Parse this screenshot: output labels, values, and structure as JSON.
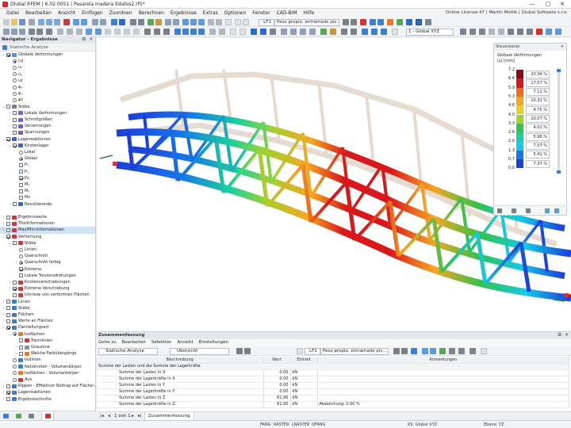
{
  "window": {
    "title": "Dlubal RFEM | 6.02.0051 | Pasarela madera Edatos2.rf5*",
    "controls": [
      "—",
      "□",
      "✕"
    ]
  },
  "menu": {
    "items": [
      "Datei",
      "Bearbeiten",
      "Ansicht",
      "Einfügen",
      "Zuordnen",
      "Berechnen",
      "Ergebnisse",
      "Extras",
      "Optionen",
      "Fenster",
      "CAD-BIM",
      "Hilfe"
    ],
    "license": "Online License 47 | Martin Motlik | Dlubal Software s.r.o."
  },
  "toolbar": {
    "lc_tag": "LF1",
    "lc_name": "Peso propio, entramado pis...",
    "view_combo": "1 - Global XYZ"
  },
  "navigator": {
    "title": "Navigator - Ergebnisse",
    "analysis": "Statische Analyse",
    "tree": [
      {
        "label": "Globale Verformungen",
        "level": 0,
        "kind": "check",
        "on": true,
        "exp": "v",
        "color": "#5b8fd6"
      },
      {
        "label": "|u|",
        "level": 1,
        "kind": "radio",
        "on": true
      },
      {
        "label": "uₓ",
        "level": 1,
        "kind": "radio",
        "on": false
      },
      {
        "label": "uᵧ",
        "level": 1,
        "kind": "radio",
        "on": false
      },
      {
        "label": "uz",
        "level": 1,
        "kind": "radio",
        "on": false
      },
      {
        "label": "φₓ",
        "level": 1,
        "kind": "radio",
        "on": false
      },
      {
        "label": "φᵧ",
        "level": 1,
        "kind": "radio",
        "on": false
      },
      {
        "label": "φz",
        "level": 1,
        "kind": "radio",
        "on": false
      },
      {
        "label": "Stäbe",
        "level": 0,
        "kind": "check",
        "on": false,
        "exp": "v",
        "color": "#7a7f88"
      },
      {
        "label": "Lokale Verformungen",
        "level": 1,
        "kind": "check",
        "on": false,
        "exp": ">",
        "color": "#7b5cc2"
      },
      {
        "label": "Schnittgrößen",
        "level": 1,
        "kind": "check",
        "on": false,
        "exp": ">",
        "color": "#7b5cc2"
      },
      {
        "label": "Verzerrungen",
        "level": 1,
        "kind": "check",
        "on": false,
        "exp": ">",
        "color": "#7b5cc2"
      },
      {
        "label": "Spannungen",
        "level": 1,
        "kind": "check",
        "on": false,
        "exp": ">",
        "color": "#7b5cc2"
      },
      {
        "label": "Lagerreaktionen",
        "level": 0,
        "kind": "check",
        "on": true,
        "exp": "v",
        "color": "#2d6bc7"
      },
      {
        "label": "Knotenlager",
        "level": 1,
        "kind": "check",
        "on": true,
        "exp": "v",
        "color": "#2d6bc7"
      },
      {
        "label": "Lokal",
        "level": 2,
        "kind": "radio",
        "on": false
      },
      {
        "label": "Global",
        "level": 2,
        "kind": "radio",
        "on": true
      },
      {
        "label": "Pₓ",
        "level": 2,
        "kind": "check",
        "on": false
      },
      {
        "label": "Pᵧ",
        "level": 2,
        "kind": "check",
        "on": false
      },
      {
        "label": "Pz",
        "level": 2,
        "kind": "check",
        "on": true
      },
      {
        "label": "Mₓ",
        "level": 2,
        "kind": "check",
        "on": false
      },
      {
        "label": "Mᵧ",
        "level": 2,
        "kind": "check",
        "on": false
      },
      {
        "label": "Mz",
        "level": 2,
        "kind": "check",
        "on": false
      },
      {
        "label": "Resultierende",
        "level": 1,
        "kind": "check",
        "on": false,
        "exp": ">",
        "color": "#2d6bc7"
      },
      {
        "label": "",
        "level": 0,
        "kind": "gap"
      },
      {
        "label": "Ergebniswerte",
        "level": 0,
        "kind": "check",
        "on": false,
        "exp": ">",
        "color": "#c23d3d"
      },
      {
        "label": "Titelinformationen",
        "level": 0,
        "kind": "check",
        "on": false,
        "exp": ">",
        "color": "#c23d3d"
      },
      {
        "label": "Max/Min-Informationen",
        "level": 0,
        "kind": "check",
        "on": false,
        "exp": ">",
        "color": "#c23d3d",
        "hl": true
      },
      {
        "label": "Verformung",
        "level": 0,
        "kind": "check",
        "on": true,
        "exp": "v",
        "color": "#c23d3d"
      },
      {
        "label": "Stäbe",
        "level": 1,
        "kind": "check",
        "on": false,
        "exp": "v",
        "color": "#c23d3d"
      },
      {
        "label": "Linien",
        "level": 2,
        "kind": "radio",
        "on": false
      },
      {
        "label": "Querschnitt",
        "level": 2,
        "kind": "radio",
        "on": false
      },
      {
        "label": "Querschnitt farbig",
        "level": 2,
        "kind": "radio",
        "on": true,
        "exp": ">"
      },
      {
        "label": "Extrema",
        "level": 2,
        "kind": "check",
        "on": true
      },
      {
        "label": "Lokale Torsionsdrehungen",
        "level": 2,
        "kind": "check",
        "on": false
      },
      {
        "label": "Knotenverschiebungen",
        "level": 1,
        "kind": "check",
        "on": false,
        "exp": ">",
        "color": "#c23d3d"
      },
      {
        "label": "Extreme Verschiebung",
        "level": 1,
        "kind": "check",
        "on": true,
        "exp": ">",
        "color": "#c23d3d"
      },
      {
        "label": "Umrisse von verformten Flächen",
        "level": 1,
        "kind": "check",
        "on": false,
        "color": "#c23d3d"
      },
      {
        "label": "Linien",
        "level": 0,
        "kind": "check",
        "on": false,
        "exp": ">",
        "color": "#3d7bc2"
      },
      {
        "label": "Stäbe",
        "level": 0,
        "kind": "check",
        "on": false,
        "exp": ">",
        "color": "#3d7bc2"
      },
      {
        "label": "Flächen",
        "level": 0,
        "kind": "check",
        "on": false,
        "exp": ">",
        "color": "#3d7bc2"
      },
      {
        "label": "Werte an Flächen",
        "level": 0,
        "kind": "check",
        "on": false,
        "exp": ">",
        "color": "#3d7bc2"
      },
      {
        "label": "Darstellungsart",
        "level": 0,
        "kind": "check",
        "on": true,
        "exp": "v",
        "color": "#3d7bc2"
      },
      {
        "label": "Isoflächen",
        "level": 1,
        "kind": "radio",
        "on": true,
        "exp": "v",
        "color": "#e8772e"
      },
      {
        "label": "Trennlinien",
        "level": 2,
        "kind": "check",
        "on": false,
        "color": "#e03030"
      },
      {
        "label": "Grauzone",
        "level": 2,
        "kind": "check",
        "on": false,
        "exp": ">",
        "color": "#8c8c8c"
      },
      {
        "label": "Weiche Farbübergänge",
        "level": 2,
        "kind": "check",
        "on": false,
        "exp": ">",
        "color": "#e8772e"
      },
      {
        "label": "Isolinien",
        "level": 1,
        "kind": "radio",
        "on": false,
        "color": "#3d7bc2"
      },
      {
        "label": "Netzknoten - Volumenkörper",
        "level": 1,
        "kind": "radio",
        "on": false,
        "color": "#3d7bc2"
      },
      {
        "label": "Isoflächen - Volumenkörper",
        "level": 1,
        "kind": "radio",
        "on": false,
        "color": "#e8772e"
      },
      {
        "label": "Aus",
        "level": 1,
        "kind": "radio",
        "on": false,
        "color": "#d93030"
      },
      {
        "label": "Rippen - Effektiver Beitrag auf Fläche/...",
        "level": 0,
        "kind": "check",
        "on": false,
        "exp": ">",
        "color": "#3d7bc2"
      },
      {
        "label": "Lagerreaktionen",
        "level": 0,
        "kind": "check",
        "on": true,
        "exp": ">",
        "color": "#3d7bc2"
      },
      {
        "label": "Ergebnisschnitte",
        "level": 0,
        "kind": "check",
        "on": false,
        "exp": ">",
        "color": "#3d7bc2"
      }
    ]
  },
  "control_panel": {
    "title": "Steuerpanel",
    "heading": "Globale Verformungen",
    "unit": "|u| [mm]",
    "legend": [
      {
        "value": "7.2",
        "color": "#8a0a1c",
        "pct": "20.34 %"
      },
      {
        "value": "6.6",
        "color": "#d7191c",
        "pct": "17.07 %"
      },
      {
        "value": "5.9",
        "color": "#f46d1c",
        "pct": "7.11 %"
      },
      {
        "value": "5.3",
        "color": "#f6a623",
        "pct": "10.32 %"
      },
      {
        "value": "4.6",
        "color": "#e6d325",
        "pct": "4.75 %"
      },
      {
        "value": "4.0",
        "color": "#a3d12e",
        "pct": "10.07 %"
      },
      {
        "value": "3.3",
        "color": "#33c24a",
        "pct": "4.01 %"
      },
      {
        "value": "2.6",
        "color": "#1bcf9c",
        "pct": "5.98 %"
      },
      {
        "value": "2.0",
        "color": "#15c9e8",
        "pct": "7.57 %"
      },
      {
        "value": "1.3",
        "color": "#1677e8",
        "pct": "5.41 %"
      },
      {
        "value": "0.7",
        "color": "#1c3ed6",
        "pct": "7.37 %"
      },
      {
        "value": "0.0",
        "color": null,
        "pct": ""
      }
    ]
  },
  "summary": {
    "title": "Zusammenfassung",
    "menu": [
      "Gehe zu",
      "Bearbeiten",
      "Selektion",
      "Ansicht",
      "Einstellungen"
    ],
    "analysis": "Statische Analyse",
    "overview": "Übersicht",
    "lc_tag": "LF1",
    "lc_name": "Peso propio, entramado pis...",
    "columns": [
      "Beschreibung",
      "Wert",
      "Einheit",
      "Anmerkungen"
    ],
    "group": "Summe der Lasten und die Summe der Lagerkräfte",
    "rows": [
      {
        "desc": "Summe der Lasten in X",
        "value": "0.00",
        "unit": "kN",
        "note": ""
      },
      {
        "desc": "Summe der Lagerkräfte in X",
        "value": "0.00",
        "unit": "kN",
        "note": ""
      },
      {
        "desc": "Summe der Lasten in Y",
        "value": "0.00",
        "unit": "kN",
        "note": ""
      },
      {
        "desc": "Summe der Lagerkräfte in Y",
        "value": "0.00",
        "unit": "kN",
        "note": ""
      },
      {
        "desc": "Summe der Lasten in Z",
        "value": "61.95",
        "unit": "kN",
        "note": ""
      },
      {
        "desc": "Summe der Lagerkräfte in Z",
        "value": "61.95",
        "unit": "kN",
        "note": "Abweichung: 0.00 %"
      }
    ],
    "pager": "1 von 1",
    "tab": "Zusammenfassung"
  },
  "status": {
    "items": [
      "FANG",
      "RASTER",
      "LRASTER",
      "OFANG"
    ],
    "ks": "KS: Global XYZ",
    "ebene": "Ebene: YZ"
  }
}
